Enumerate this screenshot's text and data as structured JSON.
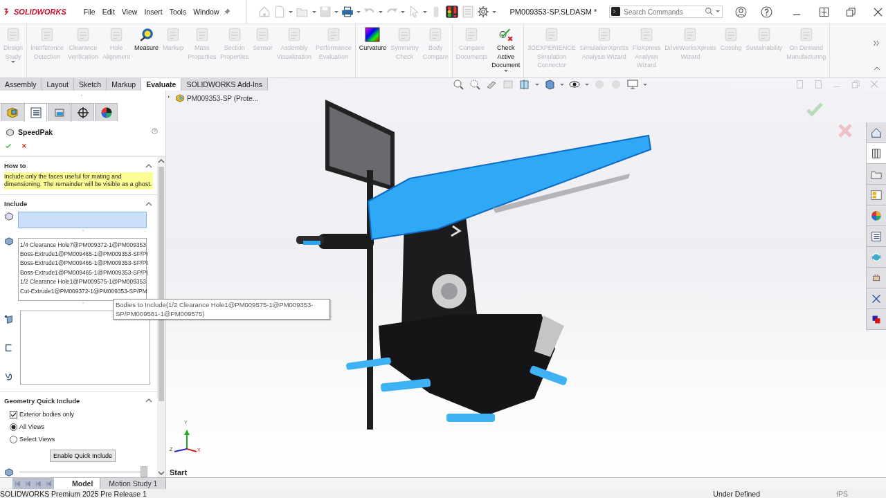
{
  "title_bar": {
    "logo": "SOLIDWORKS",
    "menus": [
      "File",
      "Edit",
      "View",
      "Insert",
      "Tools",
      "Window"
    ],
    "document_title": "PM009353-SP.SLDASM *",
    "search": {
      "placeholder": "Search Commands"
    }
  },
  "ribbon": {
    "groups": [
      {
        "commands": [
          {
            "label": "Design\nStudy",
            "enabled": false
          }
        ]
      },
      {
        "commands": [
          {
            "label": "Interference\nDetection",
            "enabled": false
          },
          {
            "label": "Clearance\nVerification",
            "enabled": false
          },
          {
            "label": "Hole\nAlignment",
            "enabled": false
          },
          {
            "label": "Measure",
            "enabled": true
          },
          {
            "label": "Markup",
            "enabled": false
          },
          {
            "label": "Mass\nProperties",
            "enabled": false
          },
          {
            "label": "Section\nProperties",
            "enabled": false
          },
          {
            "label": "Sensor",
            "enabled": false
          },
          {
            "label": "Assembly\nVisualization",
            "enabled": false
          },
          {
            "label": "Performance\nEvaluation",
            "enabled": false
          }
        ]
      },
      {
        "commands": [
          {
            "label": "Curvature",
            "enabled": true
          },
          {
            "label": "Symmetry\nCheck",
            "enabled": false
          },
          {
            "label": "Body\nCompare",
            "enabled": false
          }
        ]
      },
      {
        "commands": [
          {
            "label": "Compare\nDocuments",
            "enabled": false
          },
          {
            "label": "Check\nActive\nDocument",
            "enabled": true
          }
        ]
      },
      {
        "commands": [
          {
            "label": "3DEXPERIENCE\nSimulation\nConnector",
            "enabled": false
          },
          {
            "label": "SimulationXpress\nAnalysis Wizard",
            "enabled": false
          },
          {
            "label": "FloXpress\nAnalysis\nWizard",
            "enabled": false
          },
          {
            "label": "DriveWorksXpress\nWizard",
            "enabled": false
          },
          {
            "label": "Costing",
            "enabled": false
          },
          {
            "label": "Sustainability",
            "enabled": false
          },
          {
            "label": "On Demand\nManufacturing",
            "enabled": false
          }
        ]
      }
    ]
  },
  "command_tabs": [
    {
      "label": "Assembly",
      "selected": false
    },
    {
      "label": "Layout",
      "selected": false
    },
    {
      "label": "Sketch",
      "selected": false
    },
    {
      "label": "Markup",
      "selected": false
    },
    {
      "label": "Evaluate",
      "selected": true
    },
    {
      "label": "SOLIDWORKS Add-Ins",
      "selected": false
    }
  ],
  "property_manager": {
    "tabs": [
      {
        "selected": false
      },
      {
        "selected": true
      },
      {
        "selected": false
      },
      {
        "selected": false
      },
      {
        "selected": false
      }
    ],
    "title": "SpeedPak",
    "how_to": {
      "title": "How to",
      "expanded": true,
      "message": "Include only the faces useful for mating and dimensioning.  The remainder will be visible as a ghost."
    },
    "include": {
      "title": "Include",
      "expanded": true,
      "faces_field": {
        "active": true
      },
      "bodies": [
        "1/4 Clearance Hole7@PM009372-1@PM009353",
        "Boss-Extrude1@PM009465-1@PM009353-SP/PI",
        "Boss-Extrude1@PM009465-1@PM009353-SP/PI",
        "Boss-Extrude1@PM009465-1@PM009353-SP/PI",
        "1/2 Clearance Hole1@PM009575-1@PM009353",
        "Cut-Extrude1@PM009372-1@PM009353-SP/PM"
      ]
    },
    "geometry_quick_include": {
      "title": "Geometry Quick Include",
      "expanded": true,
      "options": [
        {
          "kind": "checkbox",
          "label": "Exterior bodies only",
          "checked": true
        },
        {
          "kind": "radio",
          "label": "All Views",
          "selected": true
        },
        {
          "kind": "radio",
          "label": "Select Views",
          "selected": false
        }
      ],
      "button": "Enable Quick Include",
      "slider": {
        "level": 1
      }
    }
  },
  "graphics": {
    "tree_root": "PM009353-SP (Prote...",
    "triad": {
      "x": "X",
      "y": "Y",
      "z": "Z"
    },
    "start_label": "Start"
  },
  "tooltip": "Bodies to Include(1/2 Clearance Hole1@PM009575-1@PM009353-SP/PM009581-1@PM009575)",
  "task_pane": [
    {
      "selected": false
    },
    {
      "selected": true
    },
    {
      "selected": false
    },
    {
      "selected": false
    },
    {
      "selected": false
    },
    {
      "selected": false
    },
    {
      "selected": false
    },
    {
      "selected": false
    },
    {
      "selected": false
    },
    {
      "selected": false
    }
  ],
  "bottom_tabs": [
    {
      "label": "Model",
      "selected": true
    },
    {
      "label": "Motion Study 1",
      "selected": false
    }
  ],
  "status_bar": {
    "product": "SOLIDWORKS Premium 2025 Pre Release 1",
    "state": "Under Defined",
    "units": "IPS"
  }
}
